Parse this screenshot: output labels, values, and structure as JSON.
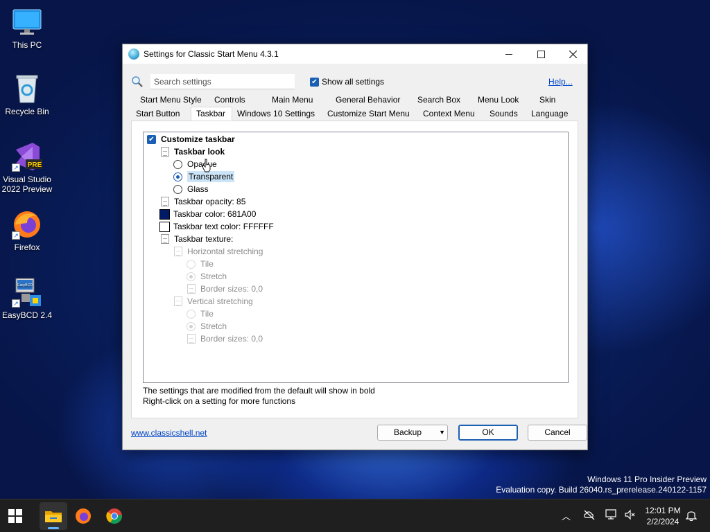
{
  "desktop": {
    "icons": [
      {
        "label": "This PC",
        "icon": "monitor-icon"
      },
      {
        "label": "Recycle Bin",
        "icon": "recycle-bin-icon"
      },
      {
        "label": "Visual Studio 2022 Preview",
        "icon": "visual-studio-icon",
        "badge": "PRE"
      },
      {
        "label": "Firefox",
        "icon": "firefox-icon"
      },
      {
        "label": "EasyBCD 2.4",
        "icon": "easybcd-icon",
        "badge": "EasyBCD"
      }
    ]
  },
  "window": {
    "title": "Settings for Classic Start Menu 4.3.1",
    "search_placeholder": "Search settings",
    "show_all_label": "Show all settings",
    "show_all_checked": true,
    "help_label": "Help...",
    "tabs_row1": [
      "Start Menu Style",
      "Controls",
      "Main Menu",
      "General Behavior",
      "Search Box",
      "Menu Look",
      "Skin"
    ],
    "tabs_row2": [
      "Start Button",
      "Taskbar",
      "Windows 10 Settings",
      "Customize Start Menu",
      "Context Menu",
      "Sounds",
      "Language"
    ],
    "active_tab": "Taskbar",
    "tree": {
      "customize_taskbar": "Customize taskbar",
      "taskbar_look": "Taskbar look",
      "opaque": "Opaque",
      "transparent": "Transparent",
      "glass": "Glass",
      "taskbar_opacity": "Taskbar opacity: 85",
      "taskbar_color": "Taskbar color: 681A00",
      "taskbar_text_color": "Taskbar text color: FFFFFF",
      "taskbar_texture": "Taskbar texture:",
      "horizontal_stretching": "Horizontal stretching",
      "h_tile": "Tile",
      "h_stretch": "Stretch",
      "h_border": "Border sizes: 0,0",
      "vertical_stretching": "Vertical stretching",
      "v_tile": "Tile",
      "v_stretch": "Stretch",
      "v_border": "Border sizes: 0,0"
    },
    "colors": {
      "taskbar_color_swatch": "#001A68",
      "taskbar_text_color_swatch": "#FFFFFF"
    },
    "note_line1": "The settings that are modified from the default will show in bold",
    "note_line2": "Right-click on a setting for more functions",
    "website_link": "www.classicshell.net",
    "backup_label": "Backup",
    "ok_label": "OK",
    "cancel_label": "Cancel"
  },
  "watermark": {
    "line1": "Windows 11 Pro Insider Preview",
    "line2": "Evaluation copy. Build 26040.rs_prerelease.240122-1157"
  },
  "taskbar": {
    "time": "12:01 PM",
    "date": "2/2/2024"
  }
}
